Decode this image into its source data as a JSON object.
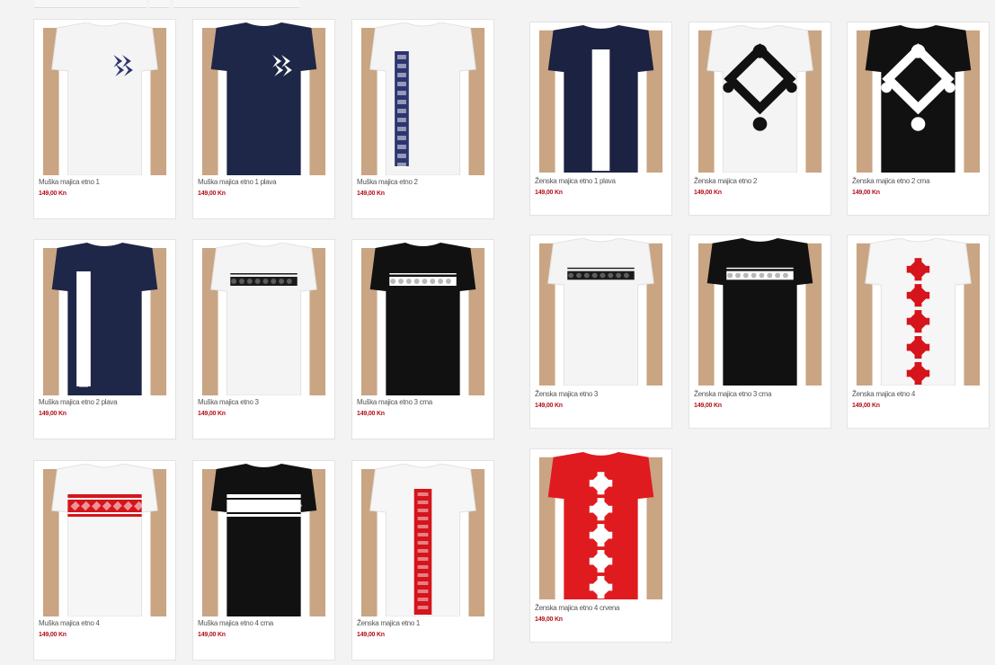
{
  "colors": {
    "price": "#b3111c",
    "card_bg": "#ffffff",
    "page_bg": "#f3f3f3"
  },
  "products": [
    {
      "name": "Muška majica etno 1",
      "price": "149,00 Kn",
      "shirt": "#f4f4f4",
      "pattern": "#2d3570",
      "motif": "arrows"
    },
    {
      "name": "Muška majica etno 1 plava",
      "price": "149,00 Kn",
      "shirt": "#1e2747",
      "pattern": "#ffffff",
      "motif": "arrows"
    },
    {
      "name": "Muška majica etno 2",
      "price": "149,00 Kn",
      "shirt": "#f4f4f4",
      "pattern": "#2d3570",
      "motif": "side-strip"
    },
    {
      "name": "Muška majica etno 2 plava",
      "price": "149,00 Kn",
      "shirt": "#1e2747",
      "pattern": "#ffffff",
      "motif": "side-strip"
    },
    {
      "name": "Muška majica etno 3",
      "price": "149,00 Kn",
      "shirt": "#f4f4f4",
      "pattern": "#1b1b1b",
      "motif": "chest-band"
    },
    {
      "name": "Muška majica etno 3 crna",
      "price": "149,00 Kn",
      "shirt": "#111111",
      "pattern": "#ffffff",
      "motif": "chest-band"
    },
    {
      "name": "Muška majica etno 4",
      "price": "149,00 Kn",
      "shirt": "#f6f6f6",
      "pattern": "#d5141c",
      "motif": "wide-band"
    },
    {
      "name": "Muška majica etno 4 crna",
      "price": "149,00 Kn",
      "shirt": "#111111",
      "pattern": "#ffffff",
      "motif": "wide-band"
    },
    {
      "name": "Ženska majica etno 1",
      "price": "149,00 Kn",
      "shirt": "#f6f6f6",
      "pattern": "#d5141c",
      "motif": "center-strip"
    },
    {
      "name": "Ženska majica etno 1 plava",
      "price": "149,00 Kn",
      "shirt": "#1c2241",
      "pattern": "#ffffff",
      "motif": "center-strip"
    },
    {
      "name": "Ženska majica etno 2",
      "price": "149,00 Kn",
      "shirt": "#f4f4f4",
      "pattern": "#111111",
      "motif": "diamond"
    },
    {
      "name": "Ženska majica etno 2 crna",
      "price": "149,00 Kn",
      "shirt": "#111111",
      "pattern": "#ffffff",
      "motif": "diamond"
    },
    {
      "name": "Ženska majica etno 3",
      "price": "149,00 Kn",
      "shirt": "#f4f4f4",
      "pattern": "#1b1b1b",
      "motif": "chest-band"
    },
    {
      "name": "Ženska majica etno 3 crna",
      "price": "149,00 Kn",
      "shirt": "#111111",
      "pattern": "#ffffff",
      "motif": "chest-band"
    },
    {
      "name": "Ženska majica etno 4",
      "price": "149,00 Kn",
      "shirt": "#f6f6f6",
      "pattern": "#d5141c",
      "motif": "stars"
    },
    {
      "name": "Ženska majica etno 4 crvena",
      "price": "149,00 Kn",
      "shirt": "#e01b1f",
      "pattern": "#ffffff",
      "motif": "stars"
    }
  ]
}
